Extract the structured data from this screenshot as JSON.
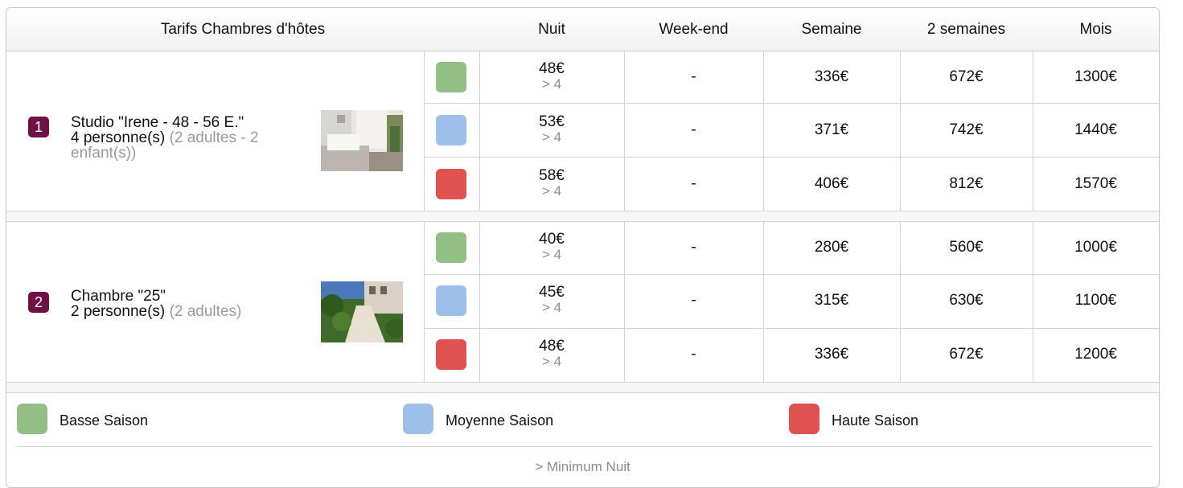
{
  "colors": {
    "basse": "#93bf85",
    "moyenne": "#9dc0ea",
    "haute": "#e05252",
    "badge": "#6f1047"
  },
  "header": {
    "title": "Tarifs Chambres d'hôtes",
    "col_nuit": "Nuit",
    "col_weekend": "Week-end",
    "col_semaine": "Semaine",
    "col_2semaines": "2 semaines",
    "col_mois": "Mois"
  },
  "rooms": [
    {
      "number": "1",
      "name": "Studio \"Irene - 48 - 56 E.\"",
      "capacity": "4 personne(s)",
      "detail": "(2 adultes - 2 enfant(s))",
      "photo_icon": "room-interior-photo",
      "rates": [
        {
          "season": "basse",
          "nuit": "48€",
          "min": "> 4",
          "weekend": "-",
          "semaine": "336€",
          "deux_semaines": "672€",
          "mois": "1300€"
        },
        {
          "season": "moyenne",
          "nuit": "53€",
          "min": "> 4",
          "weekend": "-",
          "semaine": "371€",
          "deux_semaines": "742€",
          "mois": "1440€"
        },
        {
          "season": "haute",
          "nuit": "58€",
          "min": "> 4",
          "weekend": "-",
          "semaine": "406€",
          "deux_semaines": "812€",
          "mois": "1570€"
        }
      ]
    },
    {
      "number": "2",
      "name": "Chambre \"25\"",
      "capacity": "2 personne(s)",
      "detail": "(2 adultes)",
      "photo_icon": "garden-path-photo",
      "rates": [
        {
          "season": "basse",
          "nuit": "40€",
          "min": "> 4",
          "weekend": "-",
          "semaine": "280€",
          "deux_semaines": "560€",
          "mois": "1000€"
        },
        {
          "season": "moyenne",
          "nuit": "45€",
          "min": "> 4",
          "weekend": "-",
          "semaine": "315€",
          "deux_semaines": "630€",
          "mois": "1100€"
        },
        {
          "season": "haute",
          "nuit": "48€",
          "min": "> 4",
          "weekend": "-",
          "semaine": "336€",
          "deux_semaines": "672€",
          "mois": "1200€"
        }
      ]
    }
  ],
  "legend": {
    "basse": "Basse Saison",
    "moyenne": "Moyenne Saison",
    "haute": "Haute Saison",
    "footnote": "> Minimum Nuit"
  }
}
